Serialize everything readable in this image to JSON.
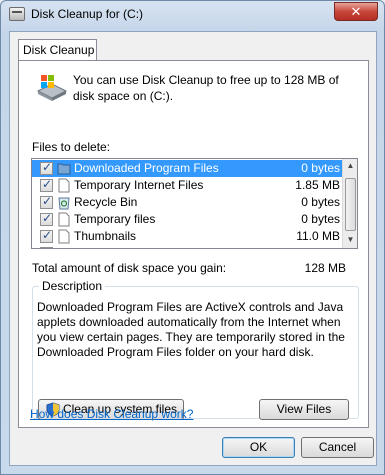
{
  "window": {
    "title": "Disk Cleanup for  (C:)",
    "close_glyph": "✕"
  },
  "tab": {
    "label": "Disk Cleanup"
  },
  "intro": {
    "text": "You can use Disk Cleanup to free up to 128 MB of disk space on  (C:)."
  },
  "files_label": "Files to delete:",
  "files": [
    {
      "name": "Downloaded Program Files",
      "size": "0 bytes",
      "checked": true,
      "selected": true,
      "icon": "folder-icon"
    },
    {
      "name": "Temporary Internet Files",
      "size": "1.85 MB",
      "checked": true,
      "selected": false,
      "icon": "page-icon"
    },
    {
      "name": "Recycle Bin",
      "size": "0 bytes",
      "checked": true,
      "selected": false,
      "icon": "recycle-bin-icon"
    },
    {
      "name": "Temporary files",
      "size": "0 bytes",
      "checked": true,
      "selected": false,
      "icon": "page-icon"
    },
    {
      "name": "Thumbnails",
      "size": "11.0 MB",
      "checked": true,
      "selected": false,
      "icon": "page-icon"
    }
  ],
  "total": {
    "label": "Total amount of disk space you gain:",
    "value": "128 MB"
  },
  "description": {
    "legend": "Description",
    "text": "Downloaded Program Files are ActiveX controls and Java applets downloaded automatically from the Internet when you view certain pages. They are temporarily stored in the Downloaded Program Files folder on your hard disk."
  },
  "buttons": {
    "cleanup_system": "Clean up system files",
    "view_files": "View Files",
    "ok": "OK",
    "cancel": "Cancel"
  },
  "help_link": "How does Disk Cleanup work?",
  "colors": {
    "selection": "#3399ff",
    "link": "#0066cc",
    "close": "#c7463b"
  }
}
